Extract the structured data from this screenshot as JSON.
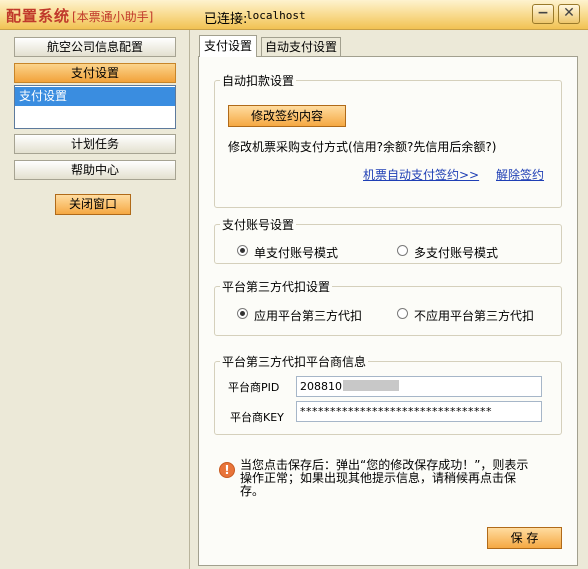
{
  "window": {
    "title": "配置系统",
    "subtitle": "[本票通小助手]",
    "connection_label": "已连接:",
    "connection_host": "localhost",
    "minimize_label": "−",
    "close_label": "✕"
  },
  "nav": {
    "items": [
      "航空公司信息配置",
      "支付设置",
      "计划任务",
      "帮助中心"
    ],
    "active_index": 1,
    "list_items": [
      "支付设置"
    ],
    "close_window_label": "关闭窗口"
  },
  "tabs": [
    "支付设置",
    "自动支付设置"
  ],
  "auto_deduct": {
    "title": "自动扣款设置",
    "button_label": "修改签约内容",
    "description": "修改机票采购支付方式(信用?余额?先信用后余额?)",
    "link_contract": "机票自动支付签约>>",
    "link_cancel": "解除签约"
  },
  "account": {
    "title": "支付账号设置",
    "options": [
      "单支付账号模式",
      "多支付账号模式"
    ],
    "selected": 0
  },
  "third_party": {
    "title": "平台第三方代扣设置",
    "options": [
      "应用平台第三方代扣",
      "不应用平台第三方代扣"
    ],
    "selected": 0
  },
  "platform_info": {
    "title": "平台第三方代扣平台商信息",
    "pid_label": "平台商PID",
    "pid_value": "2088101",
    "key_label": "平台商KEY",
    "key_value": "********************************"
  },
  "notice": {
    "icon": "!",
    "text": "当您点击保存后：弹出“您的修改保存成功！”，则表示操作正常；如果出现其他提示信息，请稍候再点击保存。"
  },
  "save_label": "保 存"
}
